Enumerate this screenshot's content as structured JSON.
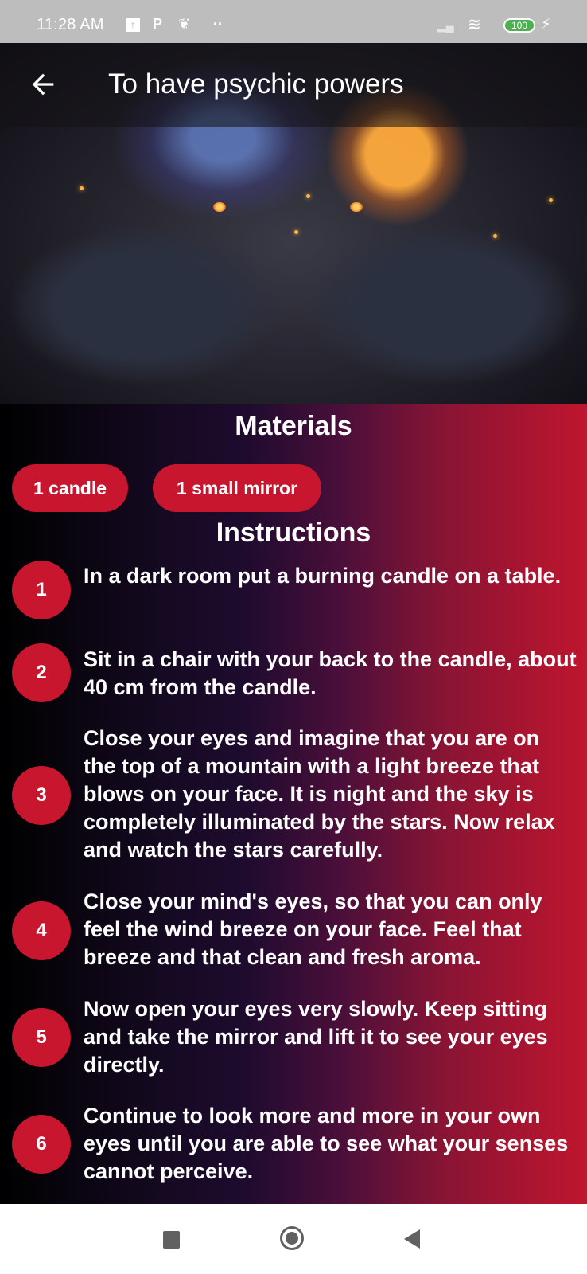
{
  "status_bar": {
    "time": "11:28 AM",
    "notification_icons": [
      "upload-icon",
      "p-icon",
      "app-icon",
      "more-dots-icon"
    ],
    "battery": "100"
  },
  "app_bar": {
    "title": "To have psychic powers",
    "back_icon": "arrow-left-icon"
  },
  "hero": {
    "description": "Two black cats with glowing orange eyes facing each other under a cosmic sky"
  },
  "materials": {
    "title": "Materials",
    "items": [
      "1 candle",
      "1 small mirror"
    ]
  },
  "instructions": {
    "title": "Instructions",
    "steps": [
      {
        "number": "1",
        "text": "In a dark room put a burning candle on a table."
      },
      {
        "number": "2",
        "text": "Sit in a chair with your back to the candle, about 40 cm from the candle."
      },
      {
        "number": "3",
        "text": "Close your eyes and imagine that you are on the top of a mountain with a light breeze that blows on your face. It is night and the sky is completely illuminated by the stars. Now relax and watch the stars carefully."
      },
      {
        "number": "4",
        "text": "Close your mind's eyes, so that you can only feel the wind breeze on your face. Feel that breeze and that clean and fresh aroma."
      },
      {
        "number": "5",
        "text": "Now open your eyes very slowly. Keep sitting and take the mirror and lift it to see your eyes directly."
      },
      {
        "number": "6",
        "text": "Continue to look more and more in your own eyes until you are able to see what your senses cannot perceive."
      }
    ]
  },
  "colors": {
    "accent": "#c8162f",
    "gradient_start": "#000000",
    "gradient_mid": "#1e0b2e",
    "gradient_end": "#c0152e"
  },
  "nav_bar": {
    "buttons": [
      "recents-icon",
      "home-icon",
      "back-icon"
    ]
  }
}
